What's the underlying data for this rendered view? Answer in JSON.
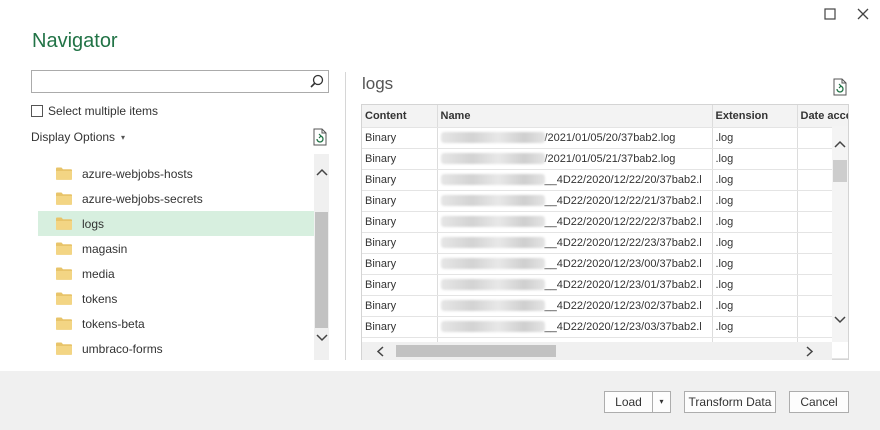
{
  "window": {
    "title": "Navigator",
    "maximize_label": "☐",
    "close_label": "✕"
  },
  "search": {
    "value": "",
    "placeholder": ""
  },
  "select_multiple": {
    "label": "Select multiple items",
    "checked": false
  },
  "display_options": {
    "label": "Display Options",
    "caret": "▾"
  },
  "tree": {
    "items": [
      {
        "label": "azure-webjobs-hosts",
        "selected": false
      },
      {
        "label": "azure-webjobs-secrets",
        "selected": false
      },
      {
        "label": "logs",
        "selected": true
      },
      {
        "label": "magasin",
        "selected": false
      },
      {
        "label": "media",
        "selected": false
      },
      {
        "label": "tokens",
        "selected": false
      },
      {
        "label": "tokens-beta",
        "selected": false
      },
      {
        "label": "umbraco-forms",
        "selected": false
      }
    ],
    "scroll_up": "︿",
    "scroll_down": "﹀"
  },
  "preview": {
    "title": "logs",
    "columns": [
      "Content",
      "Name",
      "Extension",
      "Date acces"
    ],
    "rows": [
      {
        "content": "Binary",
        "name_visible": "/2021/01/05/20/37bab2.log",
        "extension": ".log"
      },
      {
        "content": "Binary",
        "name_visible": "/2021/01/05/21/37bab2.log",
        "extension": ".log"
      },
      {
        "content": "Binary",
        "name_visible": "__4D22/2020/12/22/20/37bab2.l",
        "extension": ".log"
      },
      {
        "content": "Binary",
        "name_visible": "__4D22/2020/12/22/21/37bab2.l",
        "extension": ".log"
      },
      {
        "content": "Binary",
        "name_visible": "__4D22/2020/12/22/22/37bab2.l",
        "extension": ".log"
      },
      {
        "content": "Binary",
        "name_visible": "__4D22/2020/12/22/23/37bab2.l",
        "extension": ".log"
      },
      {
        "content": "Binary",
        "name_visible": "__4D22/2020/12/23/00/37bab2.l",
        "extension": ".log"
      },
      {
        "content": "Binary",
        "name_visible": "__4D22/2020/12/23/01/37bab2.l",
        "extension": ".log"
      },
      {
        "content": "Binary",
        "name_visible": "__4D22/2020/12/23/02/37bab2.l",
        "extension": ".log"
      },
      {
        "content": "Binary",
        "name_visible": "__4D22/2020/12/23/03/37bab2.l",
        "extension": ".log"
      }
    ]
  },
  "footer": {
    "load_label": "Load",
    "load_dropdown": "▾",
    "transform_label": "Transform Data",
    "cancel_label": "Cancel"
  },
  "colors": {
    "accent": "#217346",
    "selection": "#d7efdf",
    "footer_bg": "#f0f0f0"
  },
  "icons": [
    "search-icon",
    "refresh-icon",
    "folder-icon",
    "chevron-up-icon",
    "chevron-down-icon",
    "chevron-left-icon",
    "chevron-right-icon",
    "maximize-icon",
    "close-icon"
  ]
}
